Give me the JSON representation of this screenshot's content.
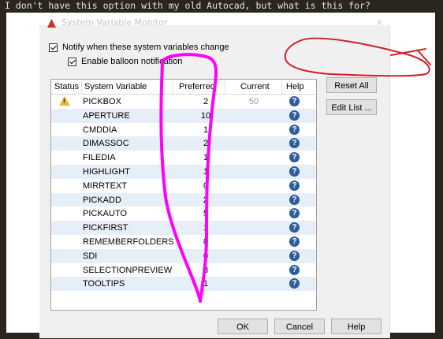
{
  "caption": "I don't have this option with my old Autocad, but what is this for?",
  "dialog": {
    "title": "System Variable Monitor",
    "close_glyph": "×",
    "notify_label": "Notify when these system variables change",
    "balloon_label": "Enable balloon notification"
  },
  "grid": {
    "columns": [
      "Status",
      "System Variable",
      "Preferred",
      "Current",
      "Help"
    ],
    "rows": [
      {
        "status": "warning",
        "name": "PICKBOX",
        "preferred": "2",
        "current": "50"
      },
      {
        "status": "",
        "name": "APERTURE",
        "preferred": "10",
        "current": ""
      },
      {
        "status": "",
        "name": "CMDDIA",
        "preferred": "1",
        "current": ""
      },
      {
        "status": "",
        "name": "DIMASSOC",
        "preferred": "2",
        "current": ""
      },
      {
        "status": "",
        "name": "FILEDIA",
        "preferred": "1",
        "current": ""
      },
      {
        "status": "",
        "name": "HIGHLIGHT",
        "preferred": "1",
        "current": ""
      },
      {
        "status": "",
        "name": "MIRRTEXT",
        "preferred": "0",
        "current": ""
      },
      {
        "status": "",
        "name": "PICKADD",
        "preferred": "2",
        "current": ""
      },
      {
        "status": "",
        "name": "PICKAUTO",
        "preferred": "5",
        "current": ""
      },
      {
        "status": "",
        "name": "PICKFIRST",
        "preferred": "1",
        "current": ""
      },
      {
        "status": "",
        "name": "REMEMBERFOLDERS",
        "preferred": "0",
        "current": ""
      },
      {
        "status": "",
        "name": "SDI",
        "preferred": "0",
        "current": ""
      },
      {
        "status": "",
        "name": "SELECTIONPREVIEW",
        "preferred": "3",
        "current": ""
      },
      {
        "status": "",
        "name": "TOOLTIPS",
        "preferred": "1",
        "current": ""
      }
    ],
    "help_glyph": "?"
  },
  "buttons": {
    "reset_all": "Reset All",
    "edit_list": "Edit List ...",
    "ok": "OK",
    "cancel": "Cancel",
    "help": "Help"
  },
  "colors": {
    "annotation_magenta": "#ff00ff",
    "annotation_red": "#d0202a",
    "row_alt": "#e6eef8",
    "help_icon": "#2d5c9a",
    "warning_icon": "#e8b84a"
  }
}
